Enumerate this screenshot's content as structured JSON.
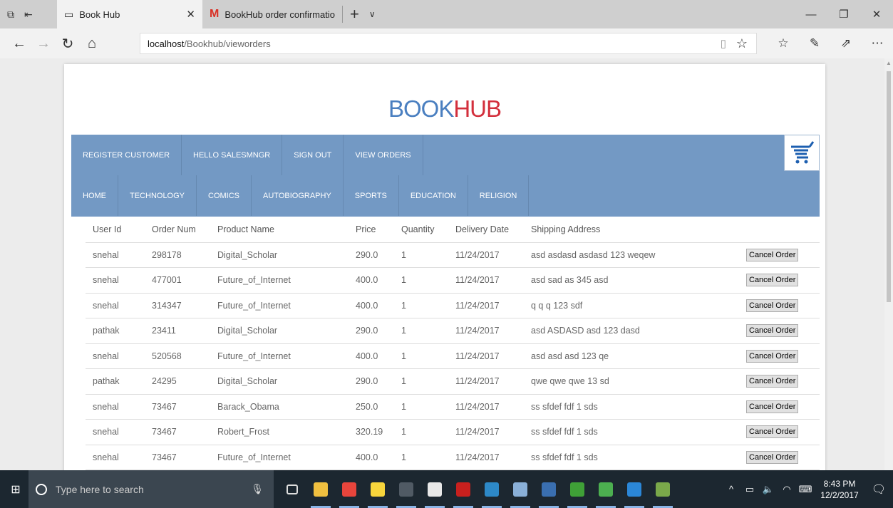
{
  "browser": {
    "tabs": [
      {
        "label": "Book Hub",
        "active": true
      },
      {
        "label": "BookHub order confirmatio",
        "active": false
      }
    ],
    "url_host": "localhost",
    "url_path": "/Bookhub/vieworders"
  },
  "site": {
    "logo_part1": "BOOK",
    "logo_part2": "HUB",
    "logo_color1": "#4a7fc0",
    "logo_color2": "#d32f3c",
    "nav_color": "#7399c4",
    "nav_top": [
      "REGISTER CUSTOMER",
      "HELLO SALESMNGR",
      "SIGN OUT",
      "VIEW ORDERS"
    ],
    "nav_bottom": [
      "HOME",
      "TECHNOLOGY",
      "COMICS",
      "AUTOBIOGRAPHY",
      "SPORTS",
      "EDUCATION",
      "RELIGION"
    ]
  },
  "orders": {
    "headers": [
      "User Id",
      "Order Num",
      "Product Name",
      "Price",
      "Quantity",
      "Delivery Date",
      "Shipping Address"
    ],
    "cancel_label": "Cancel Order",
    "rows": [
      [
        "snehal",
        "298178",
        "Digital_Scholar",
        "290.0",
        "1",
        "11/24/2017",
        "asd asdasd asdasd 123 weqew"
      ],
      [
        "snehal",
        "477001",
        "Future_of_Internet",
        "400.0",
        "1",
        "11/24/2017",
        "asd sad as 345 asd"
      ],
      [
        "snehal",
        "314347",
        "Future_of_Internet",
        "400.0",
        "1",
        "11/24/2017",
        "q q q 123 sdf"
      ],
      [
        "pathak",
        "23411",
        "Digital_Scholar",
        "290.0",
        "1",
        "11/24/2017",
        "asd ASDASD asd 123 dasd"
      ],
      [
        "snehal",
        "520568",
        "Future_of_Internet",
        "400.0",
        "1",
        "11/24/2017",
        "asd asd asd 123 qe"
      ],
      [
        "pathak",
        "24295",
        "Digital_Scholar",
        "290.0",
        "1",
        "11/24/2017",
        "qwe qwe qwe 13 sd"
      ],
      [
        "snehal",
        "73467",
        "Barack_Obama",
        "250.0",
        "1",
        "11/24/2017",
        "ss sfdef fdf 1 sds"
      ],
      [
        "snehal",
        "73467",
        "Robert_Frost",
        "320.19",
        "1",
        "11/24/2017",
        "ss sfdef fdf 1 sds"
      ],
      [
        "snehal",
        "73467",
        "Future_of_Internet",
        "400.0",
        "1",
        "11/24/2017",
        "ss sfdef fdf 1 sds"
      ]
    ]
  },
  "taskbar": {
    "search_placeholder": "Type here to search",
    "time": "8:43 PM",
    "date": "12/2/2017",
    "app_icons": [
      {
        "name": "task-view-icon",
        "color": "#1c2730"
      },
      {
        "name": "file-explorer-icon",
        "color": "#f0c040"
      },
      {
        "name": "chrome-icon",
        "color": "#e8453c"
      },
      {
        "name": "sticky-notes-icon",
        "color": "#f7d53c"
      },
      {
        "name": "terminal-icon",
        "color": "#505a64"
      },
      {
        "name": "document-icon",
        "color": "#e8e8e8"
      },
      {
        "name": "acrobat-icon",
        "color": "#c8201e"
      },
      {
        "name": "app-window-icon",
        "color": "#2d89c8"
      },
      {
        "name": "java-icon",
        "color": "#8ab0d8"
      },
      {
        "name": "netbeans-icon",
        "color": "#3a6fb0"
      },
      {
        "name": "mongodb-icon",
        "color": "#3fa037"
      },
      {
        "name": "mongodb-compass-icon",
        "color": "#4caf50"
      },
      {
        "name": "edge-icon",
        "color": "#2b87d8"
      },
      {
        "name": "paint-icon",
        "color": "#7aa84a"
      }
    ]
  }
}
